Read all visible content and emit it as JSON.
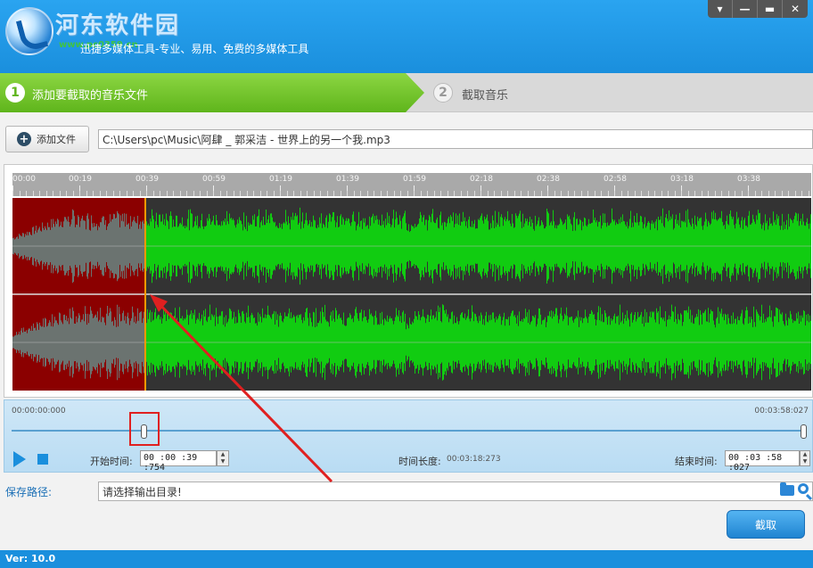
{
  "header": {
    "title": "河东软件园",
    "watermark": "www.pc0359.cn",
    "subtitle": "迅捷多媒体工具-专业、易用、免费的多媒体工具"
  },
  "window_controls": {
    "menu": "▾",
    "minimize": "—",
    "maximize": "▬",
    "close": "✕"
  },
  "steps": [
    {
      "num": "1",
      "label": "添加要截取的音乐文件"
    },
    {
      "num": "2",
      "label": "截取音乐"
    }
  ],
  "file": {
    "add_label": "添加文件",
    "path": "C:\\Users\\pc\\Music\\阿肆 _ 郭采洁 - 世界上的另一个我.mp3"
  },
  "timeline": {
    "ticks": [
      "00:00",
      "00:19",
      "00:39",
      "00:59",
      "01:19",
      "01:39",
      "01:59",
      "02:18",
      "02:38",
      "02:58",
      "03:18",
      "03:38"
    ]
  },
  "waveform": {
    "selection_start_fraction": 0.1664,
    "colors": {
      "waveform": "#11cc11",
      "background": "#333333",
      "cut": "#8b0000",
      "cut_wave": "#6b7370",
      "marker": "#ff9900"
    }
  },
  "controls": {
    "time_start": "00:00:00:000",
    "time_end": "00:03:58:027",
    "start_label": "开始时间:",
    "start_value": "00 :00 :39 :754",
    "duration_label": "时间长度:",
    "duration_value": "00:03:18:273",
    "end_label": "结束时间:",
    "end_value": "00 :03 :58 :027",
    "slider_start_fraction": 0.1664,
    "slider_end_fraction": 1.0
  },
  "save": {
    "label": "保存路径:",
    "value": "请选择输出目录!"
  },
  "cut_button": "截取",
  "version": "Ver: 10.0",
  "accent_color": "#1a8fdd",
  "step_color": "#5fb51c",
  "annotation_color": "#e02020"
}
